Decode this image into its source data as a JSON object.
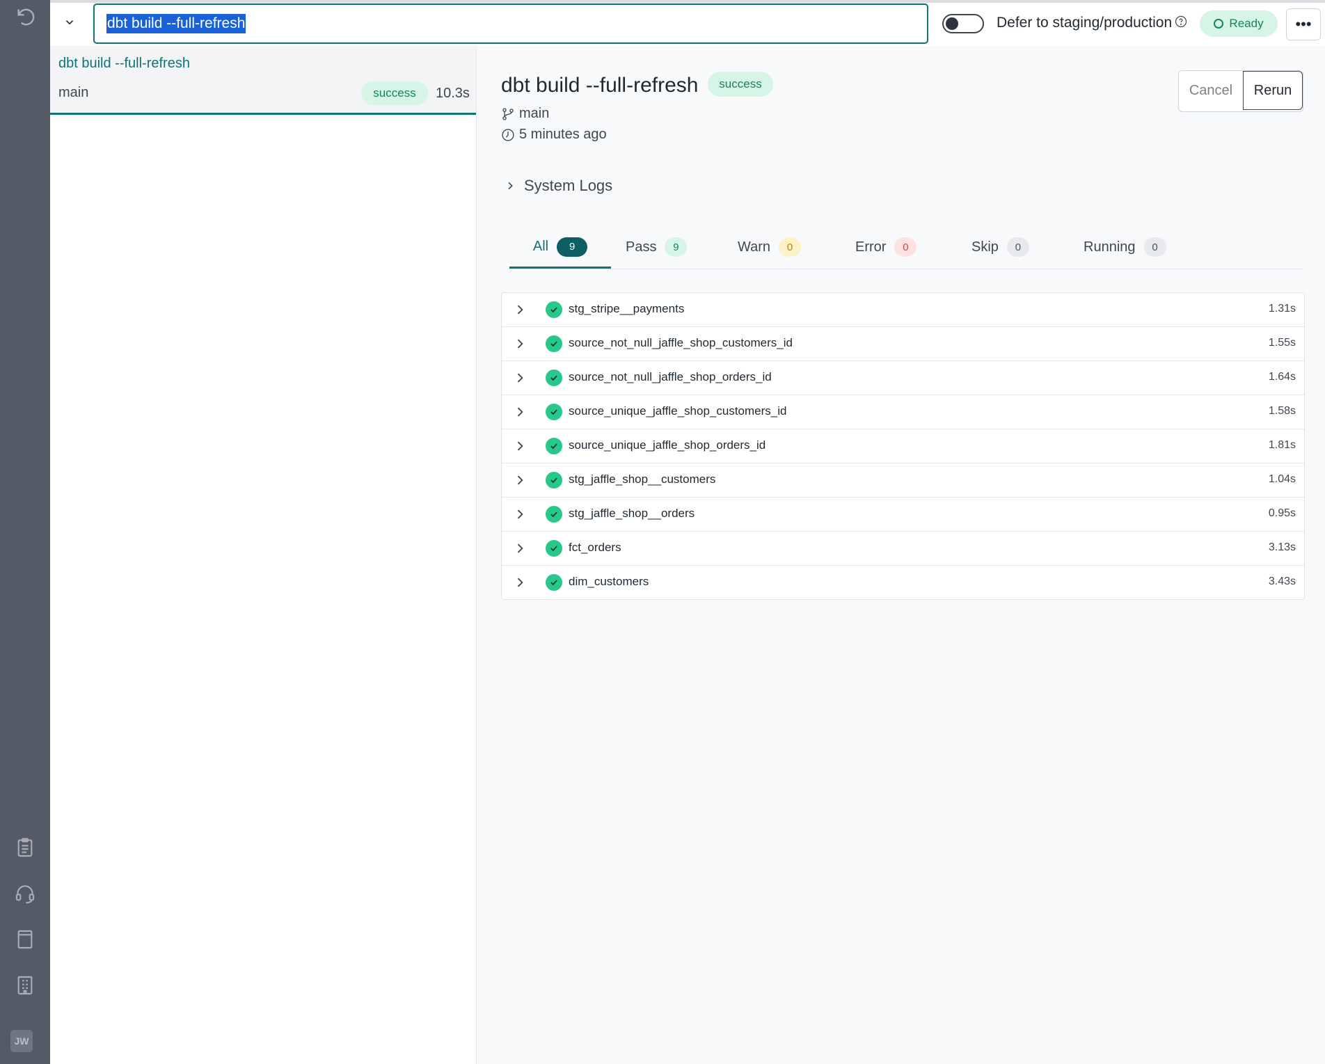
{
  "command": {
    "value": "dbt build --full-refresh"
  },
  "defer": {
    "label": "Defer to staging/production",
    "enabled": false
  },
  "status_badge": "Ready",
  "more_label": "•••",
  "rail": {
    "avatar": "JW"
  },
  "runs": [
    {
      "title": "dbt build --full-refresh",
      "branch": "main",
      "status": "success",
      "duration": "10.3s"
    }
  ],
  "detail": {
    "title": "dbt build --full-refresh",
    "status": "success",
    "branch": "main",
    "time": "5 minutes ago",
    "cancel_label": "Cancel",
    "rerun_label": "Rerun",
    "system_logs": "System Logs",
    "tabs": [
      {
        "label": "All",
        "count": "9"
      },
      {
        "label": "Pass",
        "count": "9"
      },
      {
        "label": "Warn",
        "count": "0"
      },
      {
        "label": "Error",
        "count": "0"
      },
      {
        "label": "Skip",
        "count": "0"
      },
      {
        "label": "Running",
        "count": "0"
      }
    ],
    "nodes": [
      {
        "name": "stg_stripe__payments",
        "time": "1.31s"
      },
      {
        "name": "source_not_null_jaffle_shop_customers_id",
        "time": "1.55s"
      },
      {
        "name": "source_not_null_jaffle_shop_orders_id",
        "time": "1.64s"
      },
      {
        "name": "source_unique_jaffle_shop_customers_id",
        "time": "1.58s"
      },
      {
        "name": "source_unique_jaffle_shop_orders_id",
        "time": "1.81s"
      },
      {
        "name": "stg_jaffle_shop__customers",
        "time": "1.04s"
      },
      {
        "name": "stg_jaffle_shop__orders",
        "time": "0.95s"
      },
      {
        "name": "fct_orders",
        "time": "3.13s"
      },
      {
        "name": "dim_customers",
        "time": "3.43s"
      }
    ]
  },
  "colors": {
    "accent": "#0d7377",
    "success": "#28c88a",
    "rail": "#545b66"
  }
}
